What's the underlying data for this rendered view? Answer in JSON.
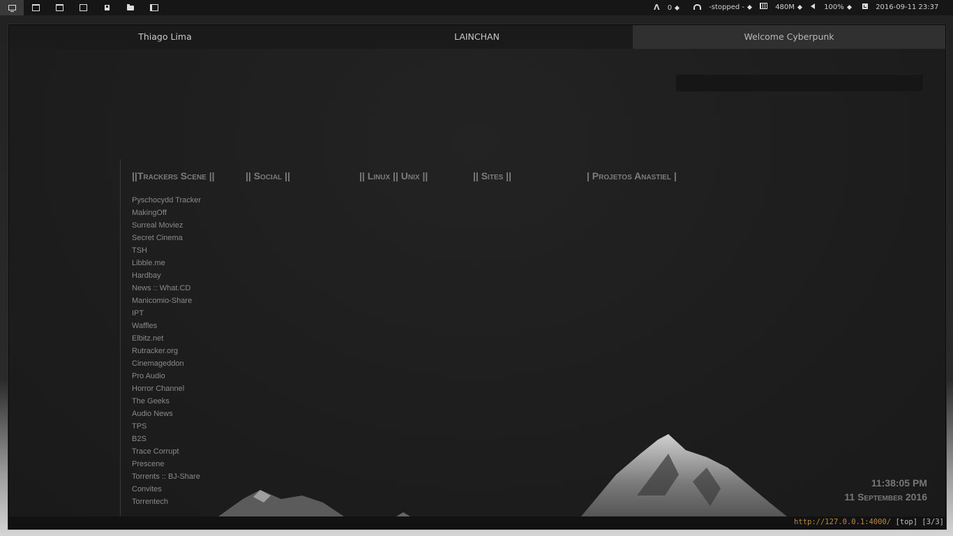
{
  "topbar": {
    "workspaces": [
      {
        "icon": "monitor-icon",
        "active": true
      },
      {
        "icon": "terminal-icon",
        "active": false
      },
      {
        "icon": "window-icon",
        "active": false
      },
      {
        "icon": "film-icon",
        "active": false
      },
      {
        "icon": "disk-icon",
        "active": false
      },
      {
        "icon": "folder-icon",
        "active": false
      },
      {
        "icon": "layout-icon",
        "active": false
      }
    ],
    "updates_count": "0",
    "music_status": "-stopped -",
    "memory": "480M",
    "volume": "100%",
    "datetime": "2016-09-11 23:37"
  },
  "browser": {
    "tabs": [
      {
        "label": "Thiago Lima",
        "active": false
      },
      {
        "label": "LAINCHAN",
        "active": false
      },
      {
        "label": "Welcome Cyberpunk",
        "active": true
      }
    ],
    "columns": [
      "||Trackers Scene ||",
      "|| Social ||",
      "|| Linux || Unix ||",
      "|| Sites ||",
      "| Projetos Anastiel |"
    ],
    "trackers_links": [
      "Pyschocydd Tracker",
      "MakingOff",
      "Surreal Moviez",
      "Secret Cinema",
      "TSH",
      "Libble.me",
      "Hardbay",
      "News :: What.CD",
      "Manicomio-Share",
      "IPT",
      "Waffles",
      "Elbitz.net",
      "Rutracker.org",
      "Cinemageddon",
      "Pro Audio",
      "Horror Channel",
      "The Geeks",
      "Audio News",
      "TPS",
      "B2S",
      "Trace Corrupt",
      "Prescene",
      "Torrents :: BJ-Share",
      "Convites",
      "Torrentech"
    ],
    "clock_time": "11:38:05 PM",
    "clock_date": "11 September 2016",
    "status_url": "http://127.0.0.1:4000/",
    "status_scroll": "[top]",
    "status_tabs": "[3/3]"
  },
  "colors": {
    "accent_url": "#b98a3c",
    "active_tab": "#303030",
    "background": "#1c1c1c"
  }
}
